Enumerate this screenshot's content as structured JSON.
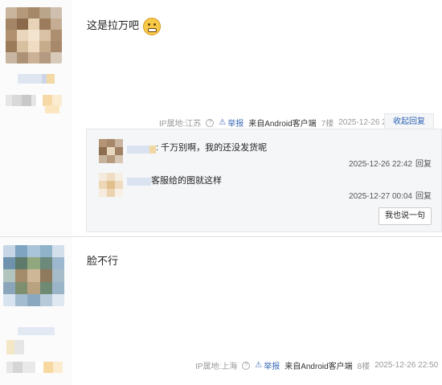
{
  "posts": [
    {
      "content": "这是拉万吧",
      "emoji": "grimace-emoji",
      "ip_label": "IP属地:江苏",
      "report": "举报",
      "source": "来自Android客户端",
      "floor": "7楼",
      "time": "2025-12-26 22:41",
      "collapse_label": "收起回复",
      "replies": [
        {
          "text": "千万别啊，我的还没发货呢",
          "time": "2025-12-26 22:42",
          "reply_label": "回复"
        },
        {
          "text": "客服给的图就这样",
          "time": "2025-12-27 00:04",
          "reply_label": "回复"
        }
      ],
      "say_button": "我也说一句"
    },
    {
      "content": "脸不行",
      "ip_label": "IP属地:上海",
      "report": "举报",
      "source": "来自Android客户端",
      "floor": "8楼",
      "time": "2025-12-26 22:50",
      "reply_label": "回复"
    }
  ],
  "colors": {
    "link": "#2d64b3",
    "meta": "#999999",
    "reply_bg": "#f5f6f8",
    "side_bg": "#fbfbfc"
  },
  "icons": [
    "help-circle-icon",
    "warning-triangle-icon",
    "emoji-icon"
  ]
}
